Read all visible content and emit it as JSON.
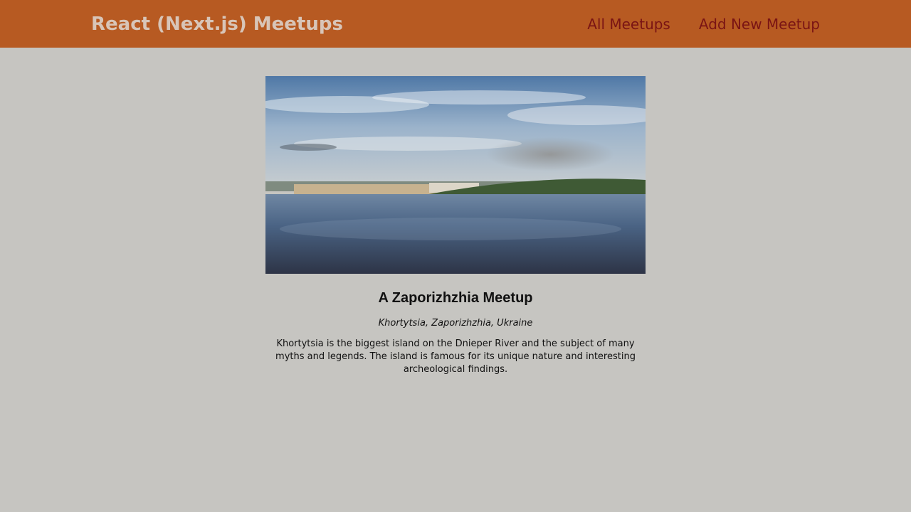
{
  "header": {
    "logo": "React (Next.js) Meetups",
    "nav": {
      "all_meetups": "All Meetups",
      "add_new_meetup": "Add New Meetup"
    }
  },
  "meetup": {
    "title": "A Zaporizhzhia Meetup",
    "address": "Khortytsia, Zaporizhzhia, Ukraine",
    "description": "Khortytsia is the biggest island on the Dnieper River and the subject of many myths and legends. The island is famous for its unique nature and interesting archeological findings."
  },
  "colors": {
    "header_bg": "#b75a22",
    "page_bg": "#c6c5c1",
    "nav_link": "#7a1414",
    "logo": "#d8c5b8"
  }
}
